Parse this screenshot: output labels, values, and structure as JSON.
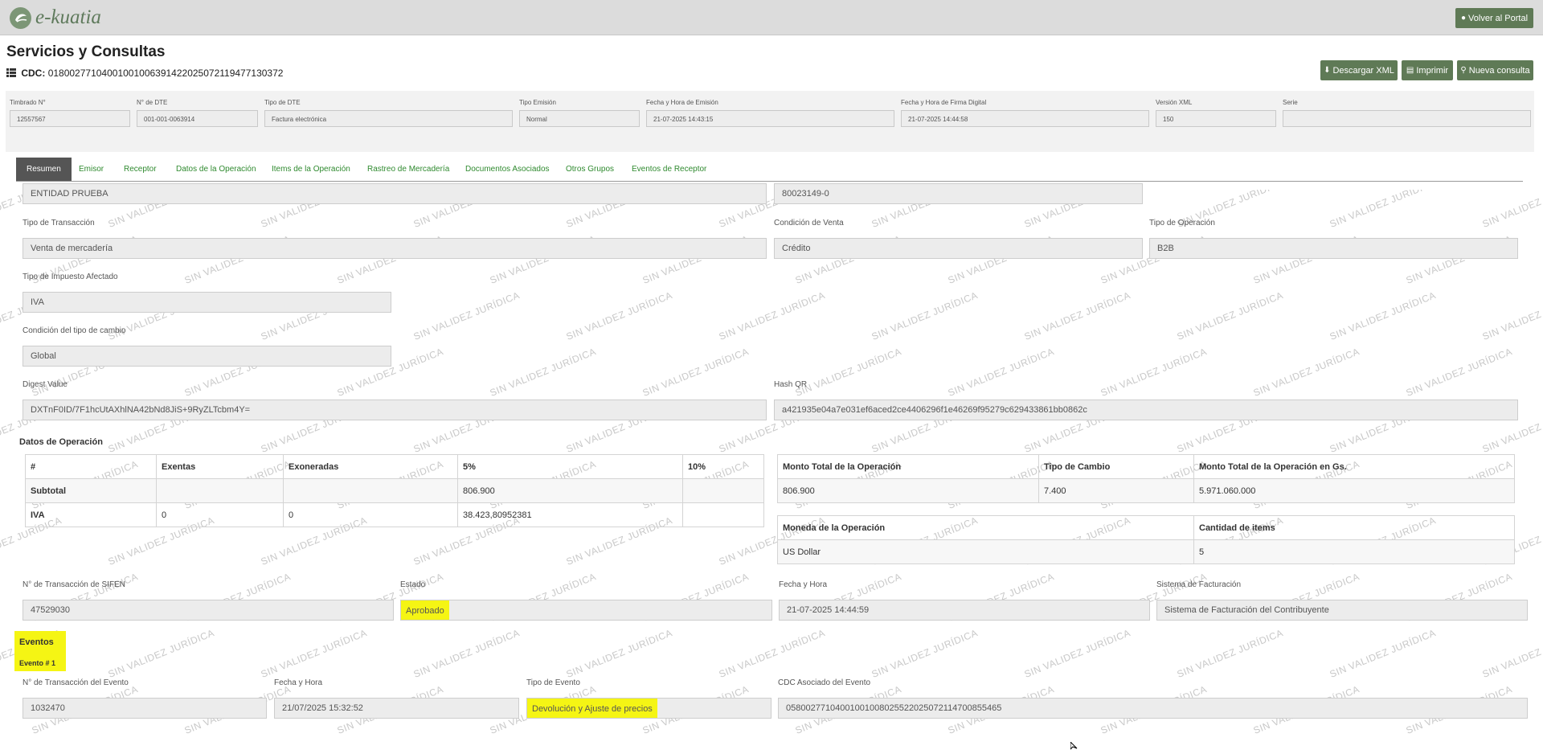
{
  "header": {
    "logo_text": "e-kuatia",
    "back_button": "Volver al Portal"
  },
  "page": {
    "title": "Servicios y Consultas",
    "cdc_label": "CDC:",
    "cdc_value": "01800277104001001006391422025072119477130372",
    "actions": {
      "xml": "Descargar XML",
      "print": "Imprimir",
      "new": "Nueva consulta"
    }
  },
  "info": {
    "timbrado": {
      "label": "Timbrado N°",
      "value": "12557567"
    },
    "nro_dte": {
      "label": "N° de DTE",
      "value": "001-001-0063914"
    },
    "tipo_dte": {
      "label": "Tipo de DTE",
      "value": "Factura electrónica"
    },
    "tipo_emision": {
      "label": "Tipo Emisión",
      "value": "Normal"
    },
    "fecha_emision": {
      "label": "Fecha y Hora de Emisión",
      "value": "21-07-2025 14:43:15"
    },
    "fecha_firma": {
      "label": "Fecha y Hora de Firma Digital",
      "value": "21-07-2025 14:44:58"
    },
    "version_xml": {
      "label": "Versión XML",
      "value": "150"
    },
    "serie": {
      "label": "Serie",
      "value": ""
    }
  },
  "tabs": [
    "Resumen",
    "Emisor",
    "Receptor",
    "Datos de la Operación",
    "Items de la Operación",
    "Rastreo de Mercadería",
    "Documentos Asociados",
    "Otros Grupos",
    "Eventos de Receptor"
  ],
  "resumen": {
    "entidad": "ENTIDAD PRUEBA",
    "ruc": "80023149-0",
    "tipo_transaccion": {
      "label": "Tipo de Transacción",
      "value": "Venta de mercadería"
    },
    "condicion_venta": {
      "label": "Condición de Venta",
      "value": "Crédito"
    },
    "tipo_operacion": {
      "label": "Tipo de Operación",
      "value": "B2B"
    },
    "tipo_impuesto": {
      "label": "Tipo de Impuesto Afectado",
      "value": "IVA"
    },
    "condicion_cambio": {
      "label": "Condición del tipo de cambio",
      "value": "Global"
    },
    "digest": {
      "label": "Digest Value",
      "value": "DXTnF0ID/7F1hcUtAXhlNA42bNd8JiS+9RyZLTcbm4Y="
    },
    "hash_qr": {
      "label": "Hash QR",
      "value": "a421935e04a7e031ef6aced2ce4406296f1e46269f95279c629433861bb0862c"
    }
  },
  "datos_operacion": {
    "title": "Datos de Operación",
    "taxes": {
      "headers": [
        "#",
        "Exentas",
        "Exoneradas",
        "5%",
        "10%"
      ],
      "rows": [
        [
          "Subtotal",
          "",
          "",
          "806.900",
          ""
        ],
        [
          "IVA",
          "0",
          "0",
          "38.423,80952381",
          ""
        ]
      ]
    },
    "totals": {
      "headers": [
        "Monto Total de la Operación",
        "Tipo de Cambio",
        "Monto Total de la Operación en Gs."
      ],
      "row": [
        "806.900",
        "7.400",
        "5.971.060.000"
      ]
    },
    "currency": {
      "headers": [
        "Moneda de la Operación",
        "Cantidad de items"
      ],
      "row": [
        "US Dollar",
        "5"
      ]
    }
  },
  "sifen": {
    "nro_transaccion": {
      "label": "N° de Transacción de SIFEN",
      "value": "47529030"
    },
    "estado": {
      "label": "Estado",
      "value": "Aprobado"
    },
    "fecha_hora": {
      "label": "Fecha y Hora",
      "value": "21-07-2025 14:44:59"
    },
    "sistema": {
      "label": "Sistema de Facturación",
      "value": "Sistema de Facturación del Contribuyente"
    }
  },
  "eventos": {
    "title": "Eventos",
    "evento_label": "Evento # 1",
    "nro_transaccion": {
      "label": "N° de Transacción del Evento",
      "value": "1032470"
    },
    "fecha_hora": {
      "label": "Fecha y Hora",
      "value": "21/07/2025 15:32:52"
    },
    "tipo_evento": {
      "label": "Tipo de Evento",
      "value": "Devolución y Ajuste de precios"
    },
    "cdc_asociado": {
      "label": "CDC Asociado del Evento",
      "value": "05800277104001001008025522025072114700855465"
    }
  },
  "watermark_text": "SIN VALIDEZ JURÍDICA",
  "colors": {
    "green_button": "#5f7a56",
    "tab_link": "#2f8a2f",
    "highlight": "#f5f514"
  }
}
